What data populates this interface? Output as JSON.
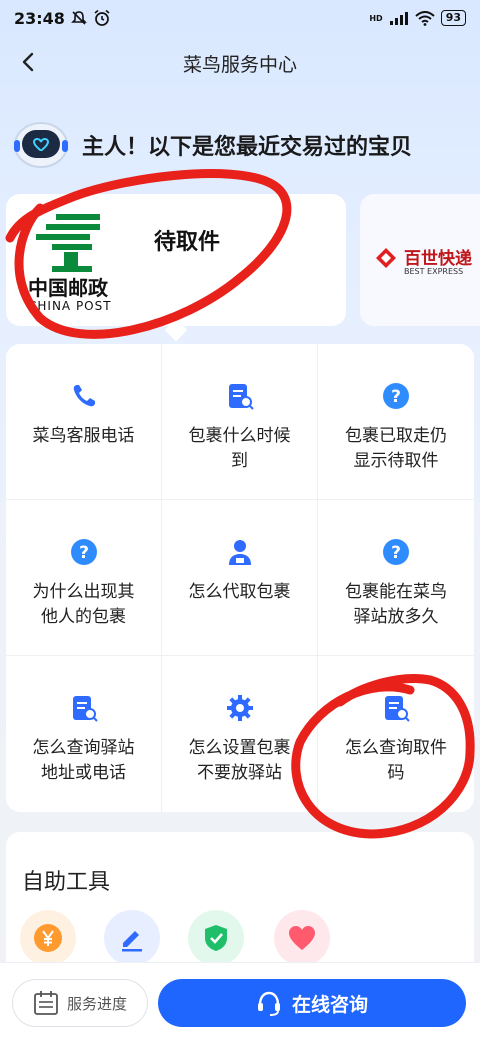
{
  "status_bar": {
    "time": "23:48",
    "battery": "93",
    "network": "HD"
  },
  "nav": {
    "title": "菜鸟服务中心"
  },
  "greeting": "主人！以下是您最近交易过的宝贝",
  "packages": [
    {
      "carrier_cn": "中国邮政",
      "carrier_en": "CHINA POST",
      "status": "待取件"
    },
    {
      "carrier_cn": "百世快递",
      "carrier_en": "BEST EXPRESS"
    }
  ],
  "faq": [
    {
      "icon": "phone-icon",
      "label": "菜鸟客服电话"
    },
    {
      "icon": "document-search-icon",
      "label": "包裹什么时候到"
    },
    {
      "icon": "question-icon",
      "label": "包裹已取走仍显示待取件"
    },
    {
      "icon": "question-icon",
      "label": "为什么出现其他人的包裹"
    },
    {
      "icon": "person-icon",
      "label": "怎么代取包裹"
    },
    {
      "icon": "question-icon",
      "label": "包裹能在菜鸟驿站放多久"
    },
    {
      "icon": "document-search-icon",
      "label": "怎么查询驿站地址或电话"
    },
    {
      "icon": "gear-icon",
      "label": "怎么设置包裹不要放驿站"
    },
    {
      "icon": "document-search-icon",
      "label": "怎么查询取件码"
    }
  ],
  "tools": {
    "title": "自助工具",
    "items": [
      {
        "icon": "yen-icon",
        "color": "#ff9a2e"
      },
      {
        "icon": "edit-icon",
        "color": "#2f6bff"
      },
      {
        "icon": "shield-check-icon",
        "color": "#1fbf6a"
      },
      {
        "icon": "heart-icon",
        "color": "#ff5a6e"
      }
    ]
  },
  "bottom": {
    "progress_label": "服务进度",
    "consult_label": "在线咨询"
  },
  "colors": {
    "accent": "#1f66ff",
    "annotation": "#e8221b"
  }
}
